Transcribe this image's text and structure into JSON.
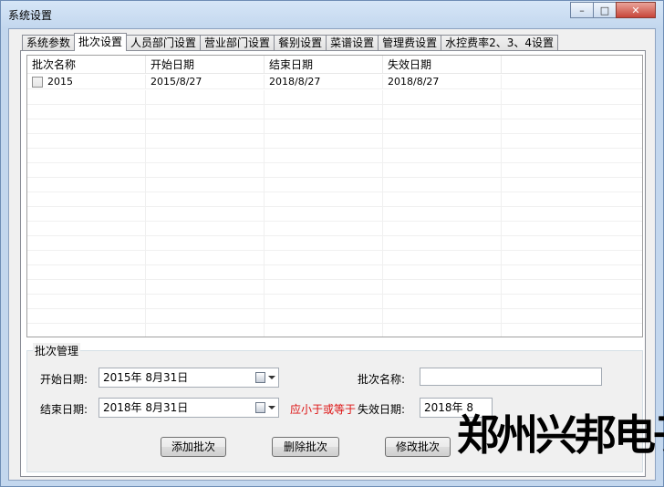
{
  "window": {
    "title": "系统设置",
    "minimize": "–",
    "maximize": "□",
    "close": "✕"
  },
  "tabs": [
    {
      "label": "系统参数"
    },
    {
      "label": "批次设置"
    },
    {
      "label": "人员部门设置"
    },
    {
      "label": "营业部门设置"
    },
    {
      "label": "餐别设置"
    },
    {
      "label": "菜谱设置"
    },
    {
      "label": "管理费设置"
    },
    {
      "label": "水控费率2、3、4设置"
    }
  ],
  "active_tab": "批次设置",
  "grid": {
    "columns": [
      "批次名称",
      "开始日期",
      "结束日期",
      "失效日期"
    ],
    "rows": [
      {
        "name": "2015",
        "start": "2015/8/27",
        "end": "2018/8/27",
        "expire": "2018/8/27",
        "checked": false
      }
    ]
  },
  "batch": {
    "legend": "批次管理",
    "start_label": "开始日期:",
    "start_value": "2015年  8月31日",
    "name_label": "批次名称:",
    "name_value": "",
    "end_label": "结束日期:",
    "end_value": "2018年  8月31日",
    "warning": "应小于或等于",
    "expire_label": "失效日期:",
    "expire_value": "2018年  8",
    "add_button": "添加批次",
    "delete_button": "删除批次",
    "modify_button": "修改批次"
  },
  "watermark": "郑州兴邦电子",
  "colors": {
    "warning": "#dd1111",
    "window_frame": "#c3d7ee"
  }
}
